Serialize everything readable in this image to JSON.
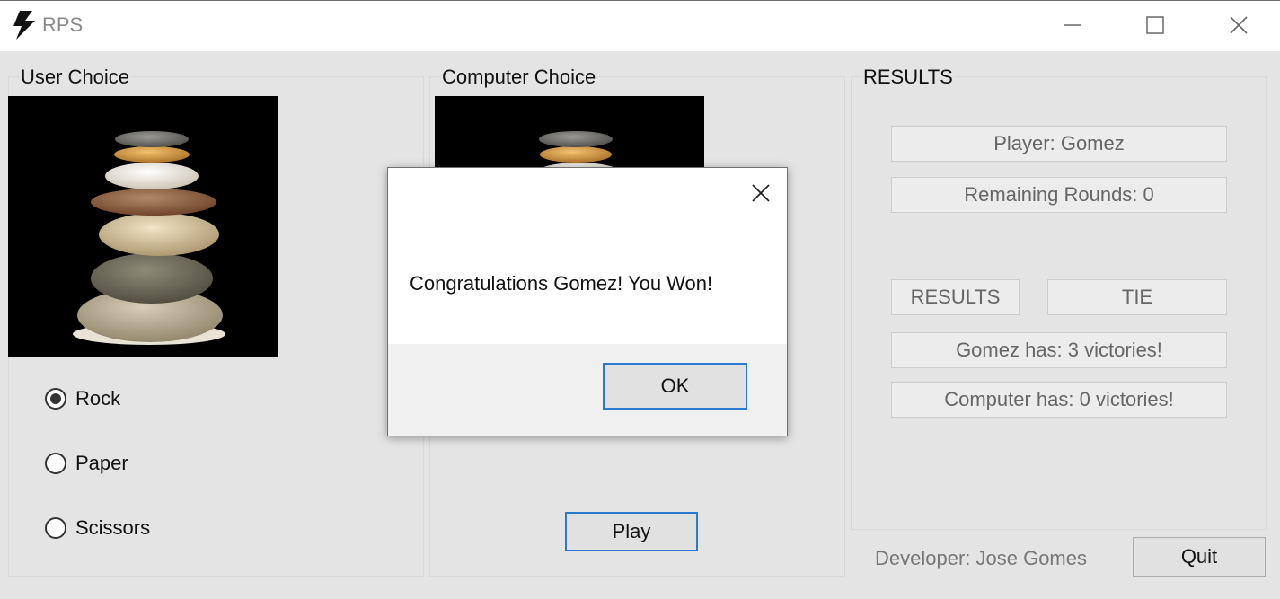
{
  "window": {
    "title": "RPS",
    "icon": "lightning-bolt-icon"
  },
  "user_panel": {
    "title": "User Choice",
    "image": "stacked-stones-image",
    "options": [
      {
        "label": "Rock",
        "selected": true
      },
      {
        "label": "Paper",
        "selected": false
      },
      {
        "label": "Scissors",
        "selected": false
      }
    ]
  },
  "computer_panel": {
    "title": "Computer Choice",
    "image": "stacked-stones-image",
    "play_label": "Play"
  },
  "results_panel": {
    "title": "RESULTS",
    "player": "Player: Gomez",
    "remaining_rounds": "Remaining Rounds: 0",
    "results_label": "RESULTS",
    "round_result": "TIE",
    "user_victories": "Gomez has: 3 victories!",
    "computer_victories": "Computer has: 0 victories!"
  },
  "footer": {
    "developer": "Developer: Jose Gomes",
    "quit_label": "Quit"
  },
  "dialog": {
    "message": "Congratulations Gomez! You Won!",
    "ok_label": "OK"
  }
}
